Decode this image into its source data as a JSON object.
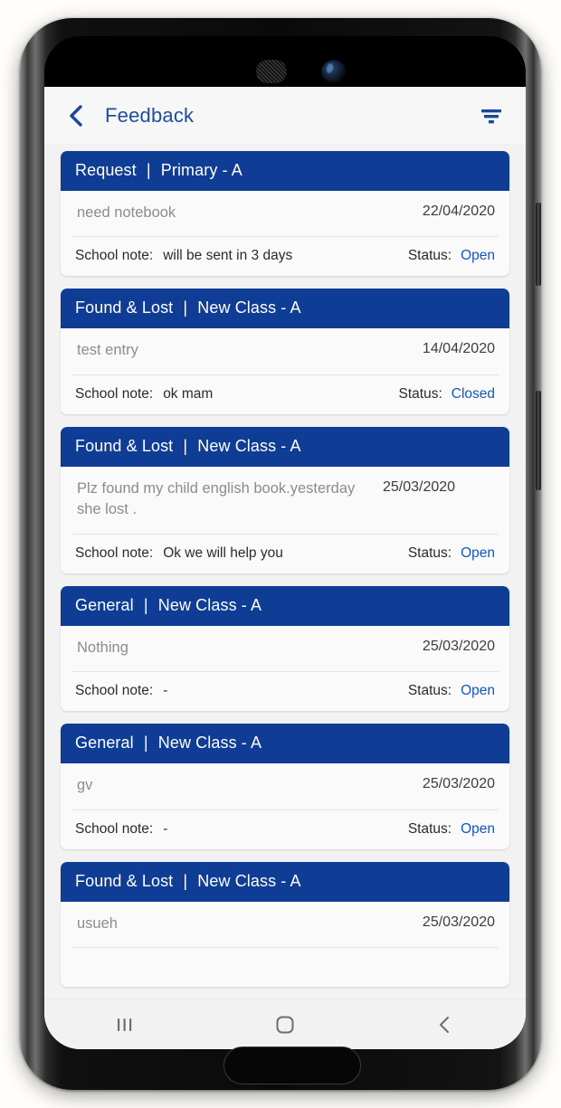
{
  "app": {
    "title": "Feedback",
    "back_icon": "chevron-left-icon",
    "filter_icon": "filter-icon",
    "accent_blue": "#0f3d96",
    "link_blue": "#1257c4",
    "title_blue": "#1a4fa0"
  },
  "labels": {
    "school_note": "School note:",
    "status": "Status:",
    "separator": "|"
  },
  "feedback": [
    {
      "category": "Request",
      "class": "Primary  - A",
      "message": "need notebook",
      "date": "22/04/2020",
      "school_note": "will be sent in 3 days",
      "status": "Open"
    },
    {
      "category": "Found  & Lost",
      "class": "New Class - A",
      "message": "test entry",
      "date": "14/04/2020",
      "school_note": "ok mam",
      "status": "Closed"
    },
    {
      "category": "Found  & Lost",
      "class": "New Class - A",
      "message": "Plz found my child  english book.yesterday she lost .",
      "date": "25/03/2020",
      "school_note": "Ok we will help you",
      "status": "Open"
    },
    {
      "category": "General",
      "class": "New Class - A",
      "message": "Nothing",
      "date": "25/03/2020",
      "school_note": "-",
      "status": "Open"
    },
    {
      "category": "General",
      "class": "New Class - A",
      "message": "gv",
      "date": "25/03/2020",
      "school_note": "-",
      "status": "Open"
    },
    {
      "category": "Found  & Lost",
      "class": "New Class - A",
      "message": "usueh",
      "date": "25/03/2020",
      "school_note": "",
      "status": "",
      "partial": true
    }
  ],
  "navbar": {
    "recents_icon": "recents-icon",
    "home_icon": "home-square-icon",
    "back_icon": "nav-back-chevron-icon"
  },
  "device": {
    "speaker_icon": "speaker-grille-icon",
    "camera_icon": "front-camera-icon",
    "home_button_icon": "home-button-pill-icon"
  }
}
